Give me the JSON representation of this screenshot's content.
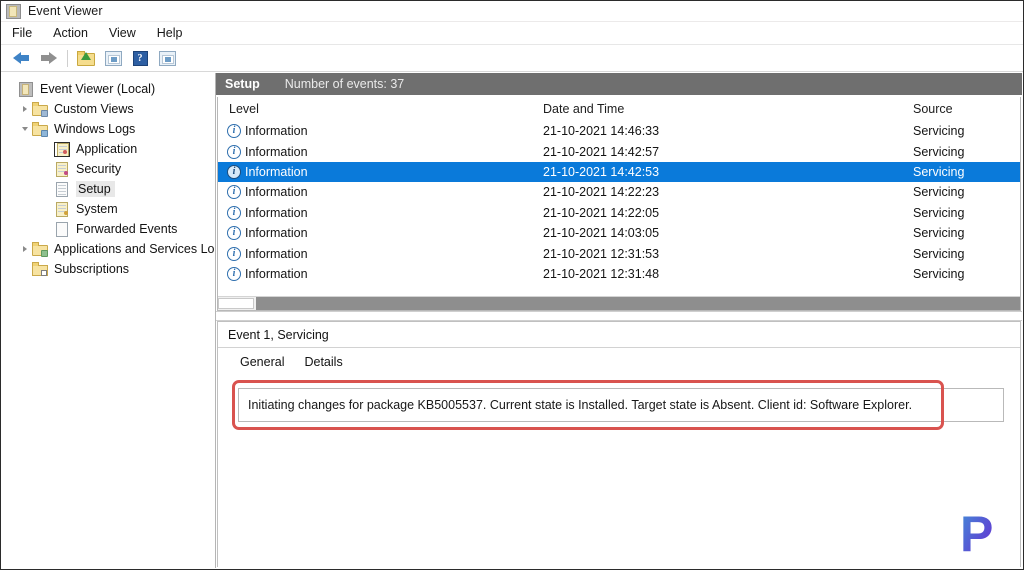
{
  "window": {
    "title": "Event Viewer",
    "icon": "event-viewer-icon"
  },
  "menubar": {
    "items": [
      {
        "label": "File"
      },
      {
        "label": "Action"
      },
      {
        "label": "View"
      },
      {
        "label": "Help"
      }
    ]
  },
  "toolbar": {
    "buttons": [
      {
        "name": "back-button",
        "icon": "arrow-left-icon",
        "label": "Back"
      },
      {
        "name": "forward-button",
        "icon": "arrow-right-icon",
        "label": "Forward"
      },
      {
        "name": "up-one-level-button",
        "icon": "folder-up-icon",
        "label": "Up One Level"
      },
      {
        "name": "show-hide-console-tree-button",
        "icon": "grid-icon",
        "label": "Show/Hide Console Tree"
      },
      {
        "name": "help-button",
        "icon": "question-mark-icon",
        "label": "Help"
      },
      {
        "name": "show-hide-action-pane-button",
        "icon": "grid-icon",
        "label": "Show/Hide Action Pane"
      }
    ]
  },
  "tree": {
    "items": [
      {
        "label": "Event Viewer (Local)",
        "icon": "console-root-icon",
        "indent": 0,
        "twisty": "none",
        "selected": false
      },
      {
        "label": "Custom Views",
        "icon": "folder-icon",
        "indent": 1,
        "twisty": "collapsed",
        "selected": false
      },
      {
        "label": "Windows Logs",
        "icon": "folder-blue-icon",
        "indent": 1,
        "twisty": "expanded",
        "selected": false
      },
      {
        "label": "Application",
        "icon": "log-application-icon",
        "indent": 2,
        "twisty": "none",
        "selected": false
      },
      {
        "label": "Security",
        "icon": "log-security-icon",
        "indent": 2,
        "twisty": "none",
        "selected": false
      },
      {
        "label": "Setup",
        "icon": "log-setup-icon",
        "indent": 2,
        "twisty": "none",
        "selected": true
      },
      {
        "label": "System",
        "icon": "log-system-icon",
        "indent": 2,
        "twisty": "none",
        "selected": false
      },
      {
        "label": "Forwarded Events",
        "icon": "log-forwarded-icon",
        "indent": 2,
        "twisty": "none",
        "selected": false
      },
      {
        "label": "Applications and Services Log",
        "icon": "folder-green-icon",
        "indent": 1,
        "twisty": "collapsed",
        "selected": false
      },
      {
        "label": "Subscriptions",
        "icon": "subscriptions-icon",
        "indent": 1,
        "twisty": "none",
        "selected": false
      }
    ]
  },
  "list": {
    "header": {
      "log_name": "Setup",
      "count_text": "Number of events: 37"
    },
    "columns": [
      {
        "label": "Level"
      },
      {
        "label": "Date and Time"
      },
      {
        "label": "Source"
      }
    ],
    "rows": [
      {
        "level": "Information",
        "datetime": "21-10-2021 14:46:33",
        "source": "Servicing",
        "selected": false
      },
      {
        "level": "Information",
        "datetime": "21-10-2021 14:42:57",
        "source": "Servicing",
        "selected": false
      },
      {
        "level": "Information",
        "datetime": "21-10-2021 14:42:53",
        "source": "Servicing",
        "selected": true
      },
      {
        "level": "Information",
        "datetime": "21-10-2021 14:22:23",
        "source": "Servicing",
        "selected": false
      },
      {
        "level": "Information",
        "datetime": "21-10-2021 14:22:05",
        "source": "Servicing",
        "selected": false
      },
      {
        "level": "Information",
        "datetime": "21-10-2021 14:03:05",
        "source": "Servicing",
        "selected": false
      },
      {
        "level": "Information",
        "datetime": "21-10-2021 12:31:53",
        "source": "Servicing",
        "selected": false
      },
      {
        "level": "Information",
        "datetime": "21-10-2021 12:31:48",
        "source": "Servicing",
        "selected": false
      }
    ]
  },
  "detail": {
    "title": "Event 1, Servicing",
    "tabs": [
      {
        "label": "General",
        "active": true
      },
      {
        "label": "Details",
        "active": false
      }
    ],
    "message": "Initiating changes for package KB5005537. Current state is Installed. Target state is Absent. Client id: Software Explorer."
  },
  "watermark": {
    "text": "P"
  },
  "colors": {
    "selection_blue": "#0a7ada",
    "header_gray": "#6f6f6f",
    "annotation_red": "#d9534f",
    "info_icon_blue": "#2f6fae"
  }
}
